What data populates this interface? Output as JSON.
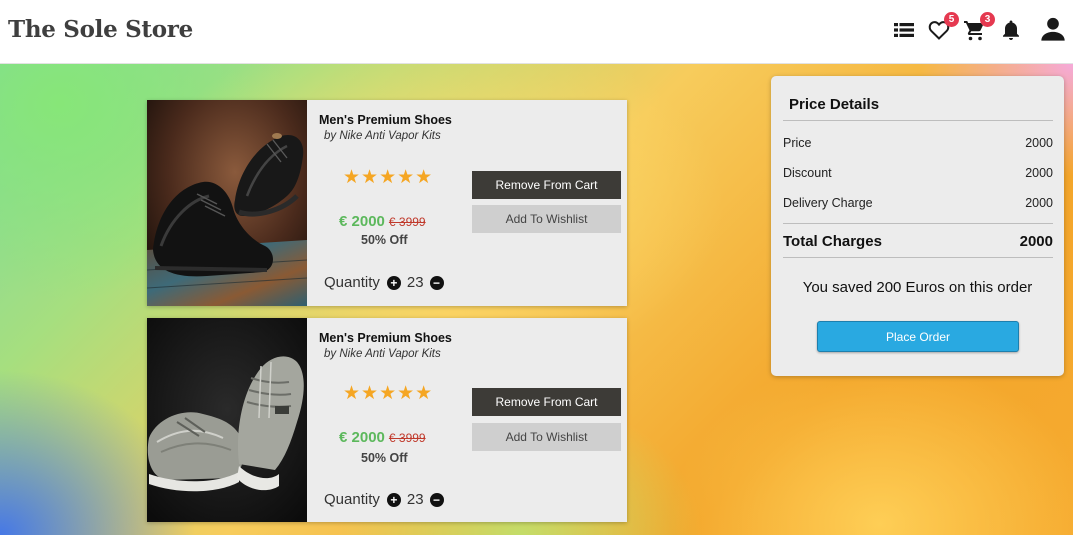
{
  "header": {
    "brand": "The Sole Store",
    "wishlist_count": "5",
    "cart_count": "3",
    "icons": [
      "list-icon",
      "heart-icon",
      "cart-icon",
      "bell-icon",
      "user-icon"
    ]
  },
  "cart_items": [
    {
      "title": "Men's Premium Shoes",
      "brand": "by Nike Anti Vapor Kits",
      "rating": "★★★★★",
      "price": "€ 2000",
      "old_price": "€ 3999",
      "discount": "50% Off",
      "quantity_label": "Quantity",
      "quantity": "23",
      "remove_label": "Remove From Cart",
      "wishlist_label": "Add To Wishlist",
      "image": "black-leather-shoes"
    },
    {
      "title": "Men's Premium Shoes",
      "brand": "by Nike Anti Vapor Kits",
      "rating": "★★★★★",
      "price": "€ 2000",
      "old_price": "€ 3999",
      "discount": "50% Off",
      "quantity_label": "Quantity",
      "quantity": "23",
      "remove_label": "Remove From Cart",
      "wishlist_label": "Add To Wishlist",
      "image": "grey-sneakers"
    }
  ],
  "price_details": {
    "title": "Price Details",
    "rows": [
      {
        "label": "Price",
        "value": "2000"
      },
      {
        "label": "Discount",
        "value": "2000"
      },
      {
        "label": "Delivery Charge",
        "value": "2000"
      }
    ],
    "total_label": "Total Charges",
    "total_value": "2000",
    "saved_text": "You saved 200 Euros on this order",
    "button_label": "Place Order"
  },
  "colors": {
    "accent": "#29a9e1",
    "price_green": "#5cb85c",
    "old_price_red": "#c0392b",
    "star": "#f5a623",
    "badge": "#e53950",
    "dark_button": "#3d3b37"
  }
}
